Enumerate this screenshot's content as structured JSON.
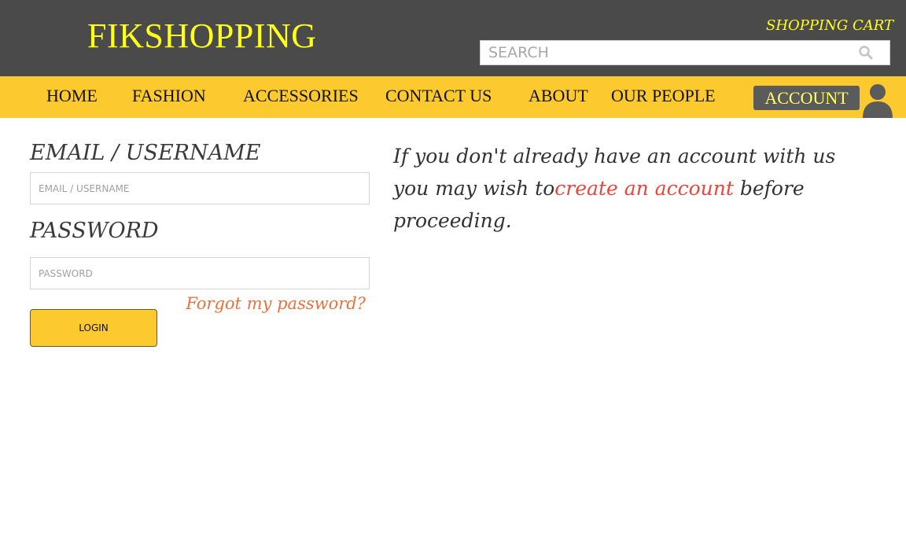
{
  "header": {
    "logo": "FIKSHOPPING",
    "cart_link": "SHOPPING CART",
    "search": {
      "placeholder": "SEARCH",
      "value": "",
      "icon": "search-icon"
    }
  },
  "nav": {
    "items": [
      {
        "label": "HOME"
      },
      {
        "label": "FASHION"
      },
      {
        "label": "ACCESSORIES"
      },
      {
        "label": "CONTACT US"
      },
      {
        "label": "ABOUT"
      },
      {
        "label": "OUR PEOPLE"
      }
    ],
    "account_label": "ACCOUNT",
    "account_icon": "user-icon"
  },
  "login": {
    "email_label": "EMAIL / USERNAME",
    "email_placeholder": "EMAIL / USERNAME",
    "password_label": "PASSWORD",
    "password_placeholder": "PASSWORD",
    "forgot_link": "Forgot my password?",
    "login_button": "LOGIN"
  },
  "info": {
    "text_before": "If you don't already have an account with us you may wish to",
    "link": "create an account",
    "text_after": " before proceeding."
  },
  "colors": {
    "header_bg": "#4a4a4a",
    "nav_bg": "#fcc92e",
    "logo": "#ffff1a",
    "link_red": "#e8473d",
    "link_orange": "#e8713d"
  }
}
